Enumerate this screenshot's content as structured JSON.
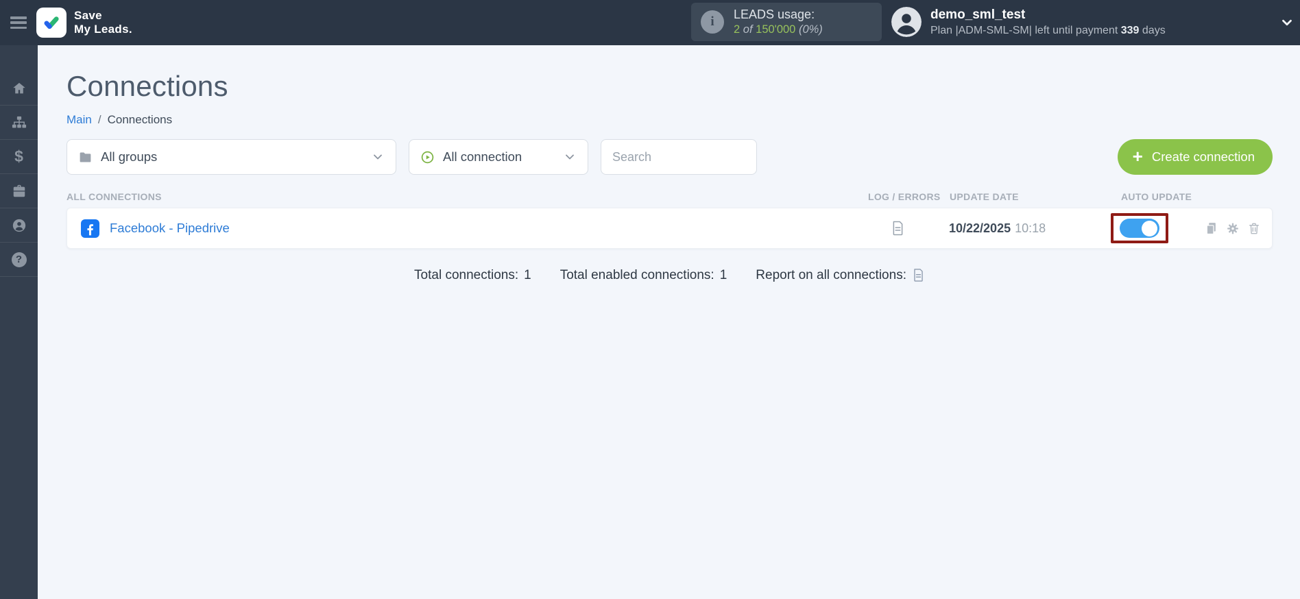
{
  "header": {
    "brand": {
      "line1": "Save",
      "line2": "My Leads."
    },
    "leads_usage": {
      "info_glyph": "i",
      "label": "LEADS usage:",
      "used": "2",
      "of_word": "of",
      "total": "150'000",
      "percent": "(0%)"
    },
    "user": {
      "name": "demo_sml_test",
      "plan_prefix": "Plan |ADM-SML-SM| left until payment",
      "days_value": "339",
      "days_suffix": "days"
    }
  },
  "sidebar": {
    "items": [
      {
        "name": "home",
        "icon": "home-icon"
      },
      {
        "name": "connections",
        "icon": "sitemap-icon"
      },
      {
        "name": "billing",
        "icon": "dollar-icon",
        "glyph": "$"
      },
      {
        "name": "services",
        "icon": "briefcase-icon"
      },
      {
        "name": "account",
        "icon": "user-circle-icon"
      },
      {
        "name": "help",
        "icon": "question-circle-icon",
        "glyph": "?"
      }
    ]
  },
  "page": {
    "title": "Connections",
    "breadcrumb": {
      "main": "Main",
      "separator": "/",
      "current": "Connections"
    }
  },
  "filters": {
    "groups_value": "All groups",
    "connection_value": "All connection",
    "search_placeholder": "Search",
    "create_plus": "+",
    "create_label": "Create connection"
  },
  "table": {
    "columns": [
      "ALL CONNECTIONS",
      "LOG / ERRORS",
      "UPDATE DATE",
      "AUTO UPDATE"
    ],
    "rows": [
      {
        "name": "Facebook - Pipedrive",
        "service_icon": "facebook-icon",
        "date": "10/22/2025",
        "time": "10:18",
        "auto_update": true
      }
    ]
  },
  "summary": {
    "total_label": "Total connections:",
    "total_value": "1",
    "enabled_label": "Total enabled connections:",
    "enabled_value": "1",
    "report_label": "Report on all connections:"
  },
  "icons": {
    "menu": "hamburger-icon",
    "logo": "checkmark-logo",
    "info": "info-icon",
    "avatar": "user-avatar-icon",
    "dropdowns": [
      "folder-icon",
      "play-circle-icon",
      "chevron-down-icon"
    ],
    "row_actions": [
      "file-icon",
      "copy-icon",
      "gear-icon",
      "trash-icon"
    ]
  },
  "colors": {
    "header_bg": "#2b3645",
    "sidebar_bg": "#343f4e",
    "accent_green": "#8bc34a",
    "usage_green": "#97c15c",
    "link_blue": "#2e7cd6",
    "facebook_blue": "#1877f2",
    "toggle_blue": "#3ea2f0",
    "annotation_red": "#8f1b15",
    "content_bg": "#f3f6fb"
  }
}
